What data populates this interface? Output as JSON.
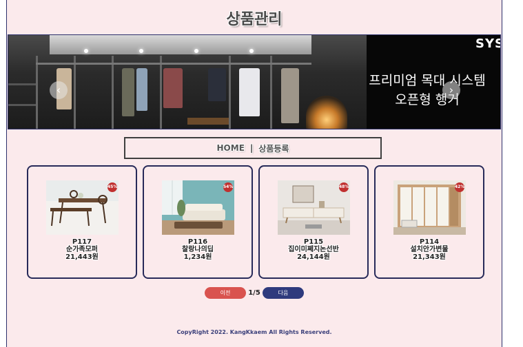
{
  "header": {
    "title": "상품관리"
  },
  "banner": {
    "brand": "SYS",
    "headline_line1": "프리미엄 목대 시스템",
    "headline_line2": "오픈형 행거",
    "prev_arrow": "‹",
    "next_arrow": "›"
  },
  "breadcrumb": {
    "home": "HOME",
    "separator": "|",
    "current": "상품등록"
  },
  "products": [
    {
      "code": "P117",
      "name": "순가족모퍼",
      "price": "21,443원",
      "badge": "45%",
      "image": "dining-table-image"
    },
    {
      "code": "P116",
      "name": "찰랑나의딥",
      "price": "1,234원",
      "badge": "54%",
      "image": "sofa-living-room-image"
    },
    {
      "code": "P115",
      "name": "집이미쩨지논선반",
      "price": "24,144원",
      "badge": "48%",
      "image": "tv-console-image"
    },
    {
      "code": "P114",
      "name": "설치안가변물",
      "price": "21,343원",
      "badge": "42%",
      "image": "wardrobe-closet-image"
    }
  ],
  "pagination": {
    "prev_label": "이전",
    "page_text": "1/5",
    "next_label": "다음"
  },
  "footer": {
    "copyright": "CopyRight 2022. KangKkaem All Rights Reserved."
  },
  "colors": {
    "page_bg": "#fbeaec",
    "card_border": "#272a59",
    "prev_btn": "#d9534f",
    "next_btn": "#2e3a7d",
    "badge": "#c0302f"
  }
}
